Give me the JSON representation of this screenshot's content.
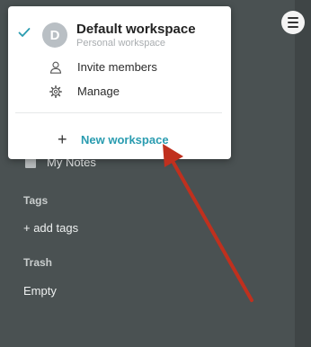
{
  "workspace_menu": {
    "current": {
      "name": "Default workspace",
      "subtitle": "Personal workspace",
      "avatar_letter": "D"
    },
    "items": [
      {
        "label": "Invite members",
        "icon": "user-icon"
      },
      {
        "label": "Manage",
        "icon": "gear-icon"
      }
    ],
    "new_workspace_label": "New workspace",
    "accent_color": "#2a9cb0"
  },
  "sidebar": {
    "notebook": {
      "label": "My Notes"
    },
    "tags": {
      "title": "Tags",
      "action": "+ add tags"
    },
    "trash": {
      "title": "Trash",
      "status": "Empty"
    }
  },
  "annotation": {
    "color": "#c0301e"
  }
}
